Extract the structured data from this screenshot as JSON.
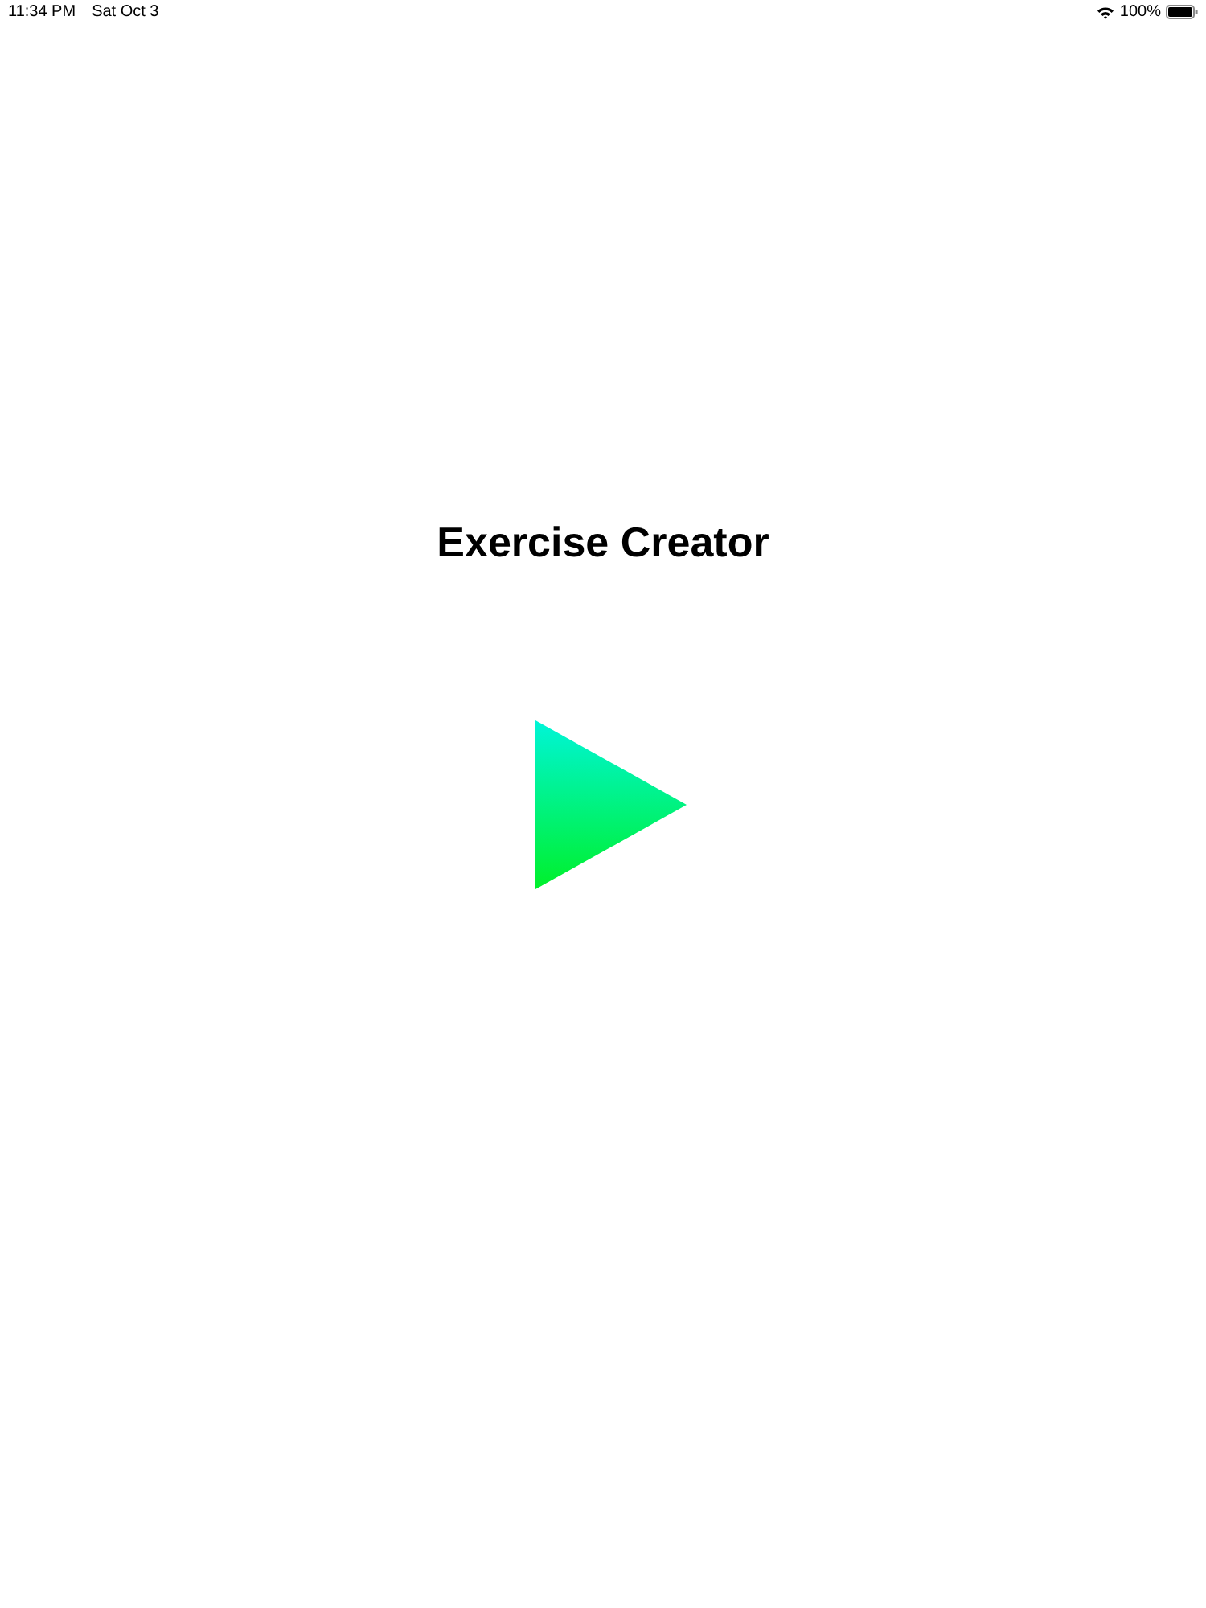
{
  "status_bar": {
    "time": "11:34 PM",
    "date": "Sat Oct 3",
    "battery": "100%"
  },
  "title": "Exercise Creator"
}
